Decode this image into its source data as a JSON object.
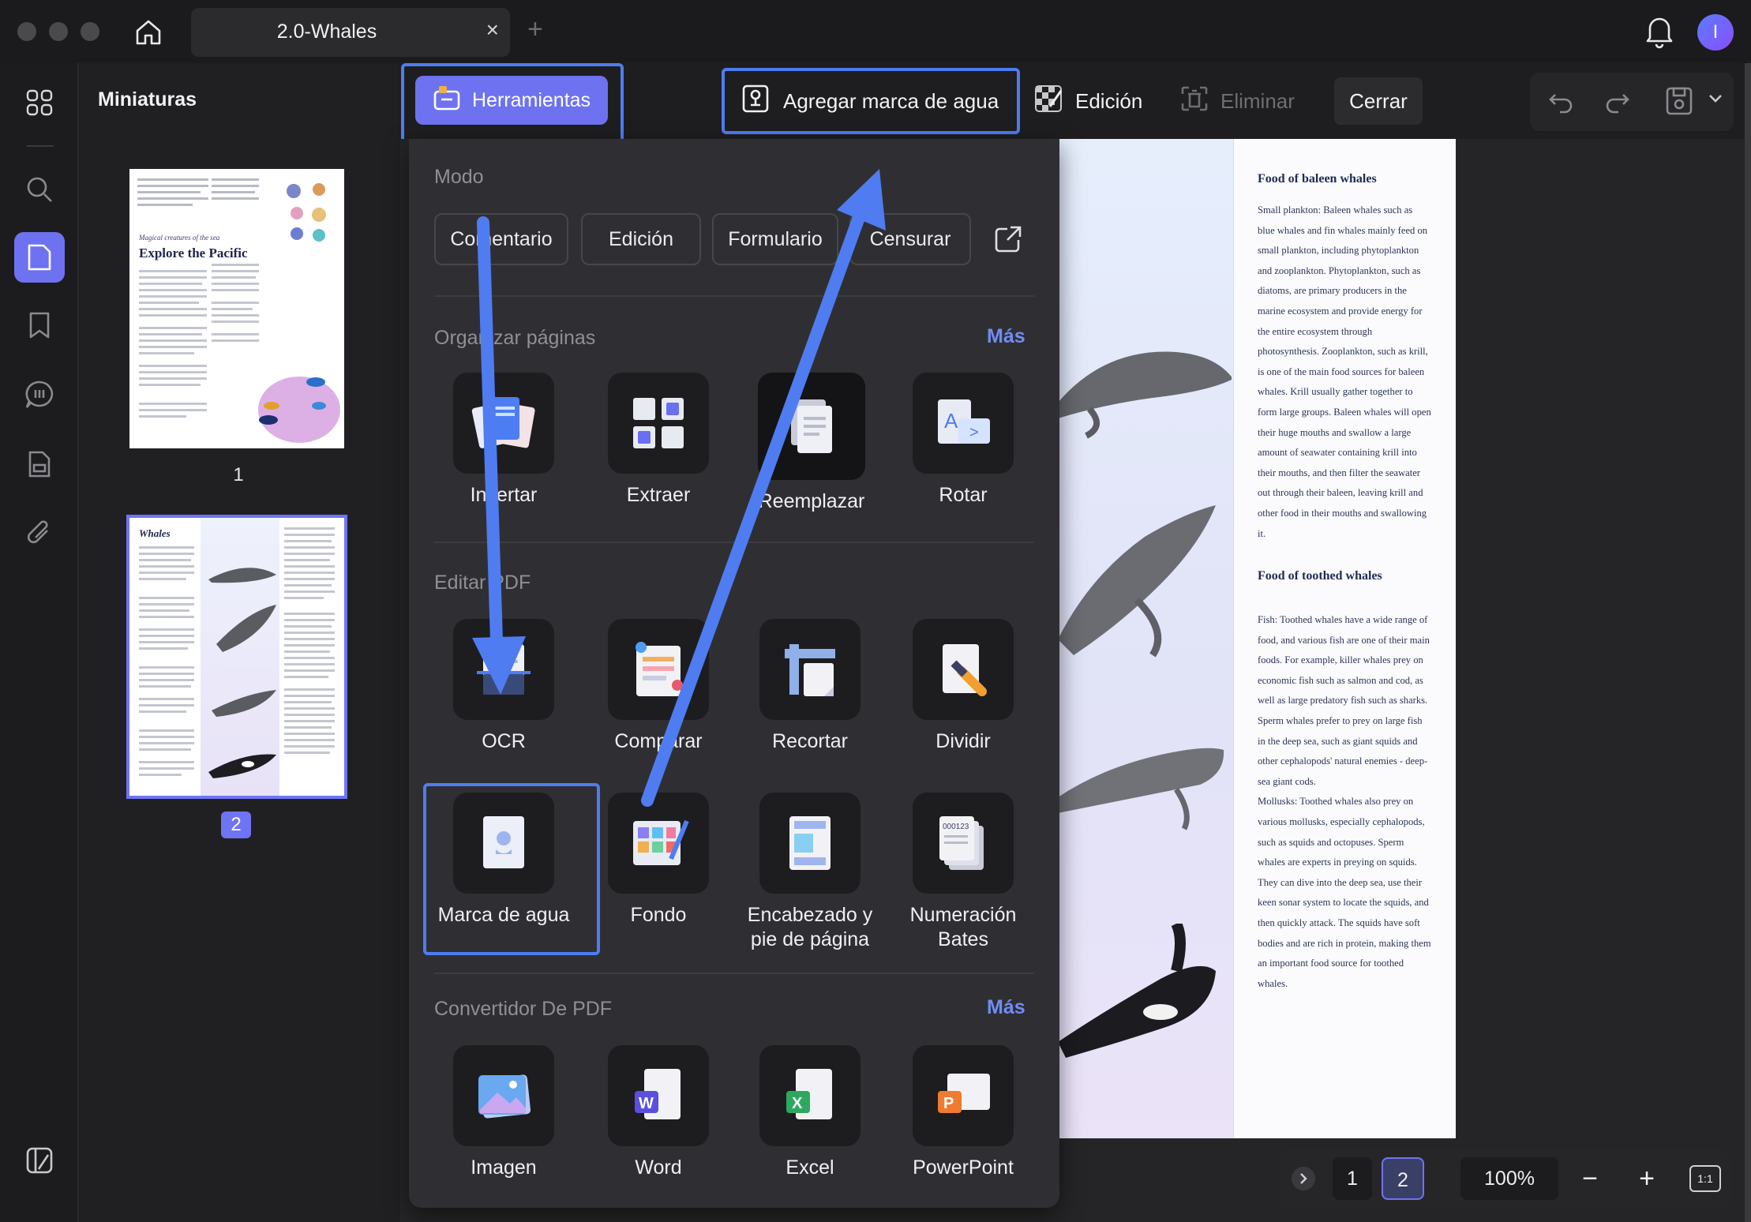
{
  "window": {
    "tab_title": "2.0-Whales",
    "tab_close": "×",
    "new_tab": "+",
    "avatar_initial": "I"
  },
  "sidebar": {
    "title": "Miniaturas"
  },
  "thumbnails": [
    {
      "page": "1"
    },
    {
      "page": "2"
    }
  ],
  "toolbar": {
    "tools_label": "Herramientas",
    "watermark_add_label": "Agregar marca de agua",
    "edit_label": "Edición",
    "delete_label": "Eliminar",
    "close_label": "Cerrar"
  },
  "panel": {
    "mode_title": "Modo",
    "modes": [
      "Comentario",
      "Edición",
      "Formulario",
      "Censurar"
    ],
    "organize_title": "Organizar páginas",
    "organize_more": "Más",
    "organize_tools": [
      "Insertar",
      "Extraer",
      "Reemplazar",
      "Rotar"
    ],
    "edit_title": "Editar PDF",
    "edit_tools_row1": [
      "OCR",
      "Comparar",
      "Recortar",
      "Dividir"
    ],
    "edit_tools_row2": [
      "Marca de agua",
      "Fondo",
      "Encabezado y pie de página",
      "Numeración Bates"
    ],
    "convert_title": "Convertidor De PDF",
    "convert_more": "Más",
    "convert_tools": [
      "Imagen",
      "Word",
      "Excel",
      "PowerPoint"
    ]
  },
  "document": {
    "heading1": "Food of baleen whales",
    "para1": "Small plankton: Baleen whales such as blue whales and fin whales mainly feed on small plankton, including phytoplankton and zooplankton. Phytoplankton, such as diatoms, are primary producers in the marine ecosystem and provide energy for the entire ecosystem through photosynthesis. Zooplankton, such as krill, is one of the main food sources for baleen whales. Krill usually gather together to form large groups. Baleen whales will open their huge mouths and swallow a large amount of seawater containing krill into their mouths, and then filter the seawater out through their baleen, leaving krill and other food in their mouths and swallowing it.",
    "heading2": "Food of toothed whales",
    "para2": "Fish: Toothed whales have a wide range of food, and various fish are one of their main foods. For example, killer whales prey on economic fish such as salmon and cod, as well as large predatory fish such as sharks. Sperm whales prefer to prey on large fish in the deep sea, such as giant squids and other cephalopods' natural enemies - deep-sea giant cods.",
    "para3": "Mollusks: Toothed whales also prey on various mollusks, especially cephalopods, such as squids and octopuses. Sperm whales are experts in preying on squids. They can dive into the deep sea, use their keen sonar system to locate the squids, and then quickly attack. The squids have soft bodies and are rich in protein, making them an important food source for toothed whales."
  },
  "pagenav": {
    "page1": "1",
    "page2": "2",
    "zoom": "100%",
    "zoom_out": "−",
    "zoom_in": "+",
    "fit": "1:1"
  },
  "colors": {
    "accent": "#6e72f0",
    "highlight": "#4f7cf0",
    "link": "#6f8df5"
  }
}
